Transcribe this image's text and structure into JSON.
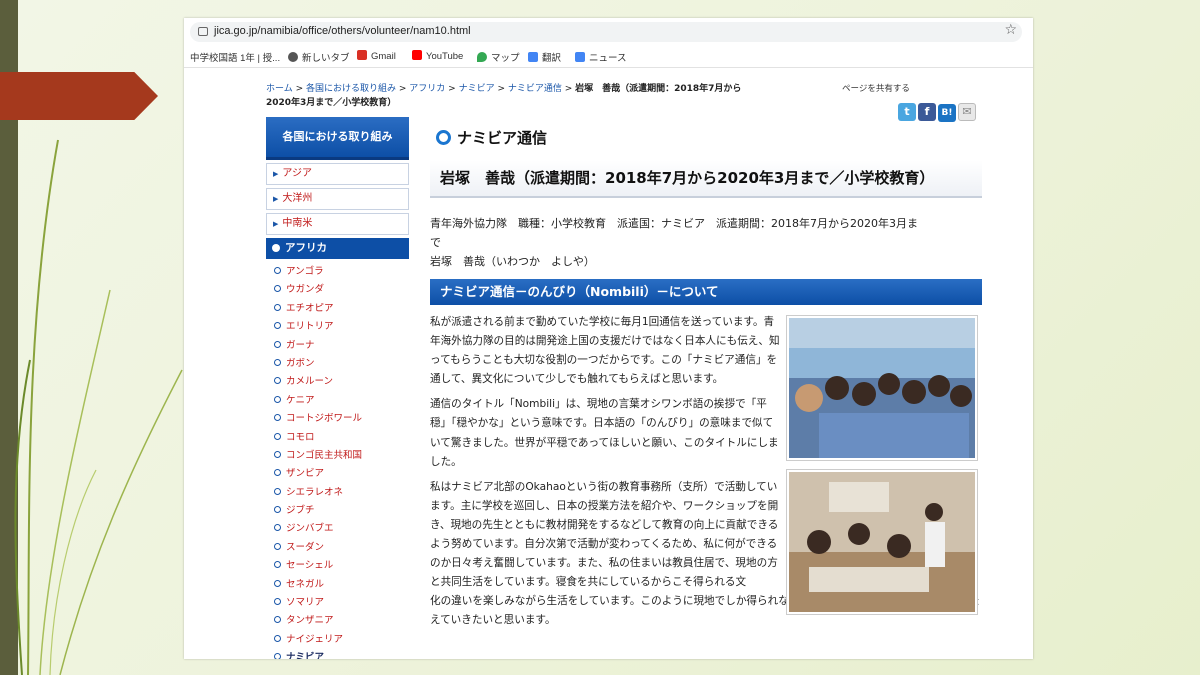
{
  "browser": {
    "url": "jica.go.jp/namibia/office/others/volunteer/nam10.html",
    "bookmarks": [
      {
        "label": "中学校国語 1年 | 授...",
        "icon": "bookmark-doc-icon",
        "color": "#4a90d9"
      },
      {
        "label": "新しいタブ",
        "icon": "globe-icon",
        "color": "#555555"
      },
      {
        "label": "Gmail",
        "icon": "gmail-icon",
        "color": "#d93025"
      },
      {
        "label": "YouTube",
        "icon": "youtube-icon",
        "color": "#ff0000"
      },
      {
        "label": "マップ",
        "icon": "maps-icon",
        "color": "#34a853"
      },
      {
        "label": "翻訳",
        "icon": "translate-icon",
        "color": "#4285f4"
      },
      {
        "label": "ニュース",
        "icon": "news-icon",
        "color": "#4285f4"
      }
    ]
  },
  "breadcrumb": {
    "items": [
      "ホーム",
      "各国における取り組み",
      "アフリカ",
      "ナミビア",
      "ナミビア通信"
    ],
    "current": "岩塚　善哉（派遣期間：2018年7月から2020年3月まで／小学校教育）"
  },
  "share": {
    "label": "ページを共有する",
    "buttons": [
      "t",
      "f",
      "B!",
      "✉"
    ]
  },
  "sidebar": {
    "header": "各国における取り組み",
    "regions": [
      "アジア",
      "大洋州",
      "中南米"
    ],
    "selected": "アフリカ",
    "countries": [
      "アンゴラ",
      "ウガンダ",
      "エチオピア",
      "エリトリア",
      "ガーナ",
      "ガボン",
      "カメルーン",
      "ケニア",
      "コートジボワール",
      "コモロ",
      "コンゴ民主共和国",
      "ザンビア",
      "シエラレオネ",
      "ジブチ",
      "ジンバブエ",
      "スーダン",
      "セーシェル",
      "セネガル",
      "ソマリア",
      "タンザニア",
      "ナイジェリア",
      "ナミビア"
    ],
    "current_country": "ナミビア"
  },
  "main": {
    "title": "ナミビア通信",
    "subtitle": "岩塚　善哉（派遣期間：2018年7月から2020年3月まで／小学校教育）",
    "meta_line1": "青年海外協力隊　職種：小学校教育　派遣国：ナミビア　派遣期間：2018年7月から2020年3月ま",
    "meta_line2": "で",
    "meta_line3": "岩塚　善哉（いわつか　よしや）",
    "section_title": "ナミビア通信－のんびり（Nombili）－について",
    "para1": "私が派遣される前まで勤めていた学校に毎月1回通信を送っています。青年海外協力隊の目的は開発途上国の支援だけではなく日本人にも伝え、知ってもらうことも大切な役割の一つだからです。この「ナミビア通信」を通して、異文化について少しでも触れてもらえばと思います。",
    "para2": "通信のタイトル「Nombili」は、現地の言葉オシワンボ語の挨拶で「平穏」「穏やかな」という意味です。日本語の「のんびり」の意味まで似ていて驚きました。世界が平穏であってほしいと願い、このタイトルにしました。",
    "para3a": "私はナミビア北部のOkahaoという街の教育事務所（支所）で活動しています。主に学校を巡回し、日本の授業方法を紹介や、ワークショップを開き、現地の先生とともに教材開発をするなどして教育の向上に貢献できるよう努めています。自分次第で活動が変わってくるため、私に何ができるのか日々考え奮闘しています。また、私の住まいは教員住居で、現地の方と共同生活をしています。寝食を共にしているからこそ得られる文",
    "para3b": "化の違いを楽しみながら生活をしています。このように現地でしか得られない経験をこのナミビア通信を通じて、伝えていきたいと思います。"
  },
  "colors": {
    "jica_blue": "#0d4fa6",
    "link_red": "#c01a1a",
    "slide_arrow": "#a5391d"
  }
}
